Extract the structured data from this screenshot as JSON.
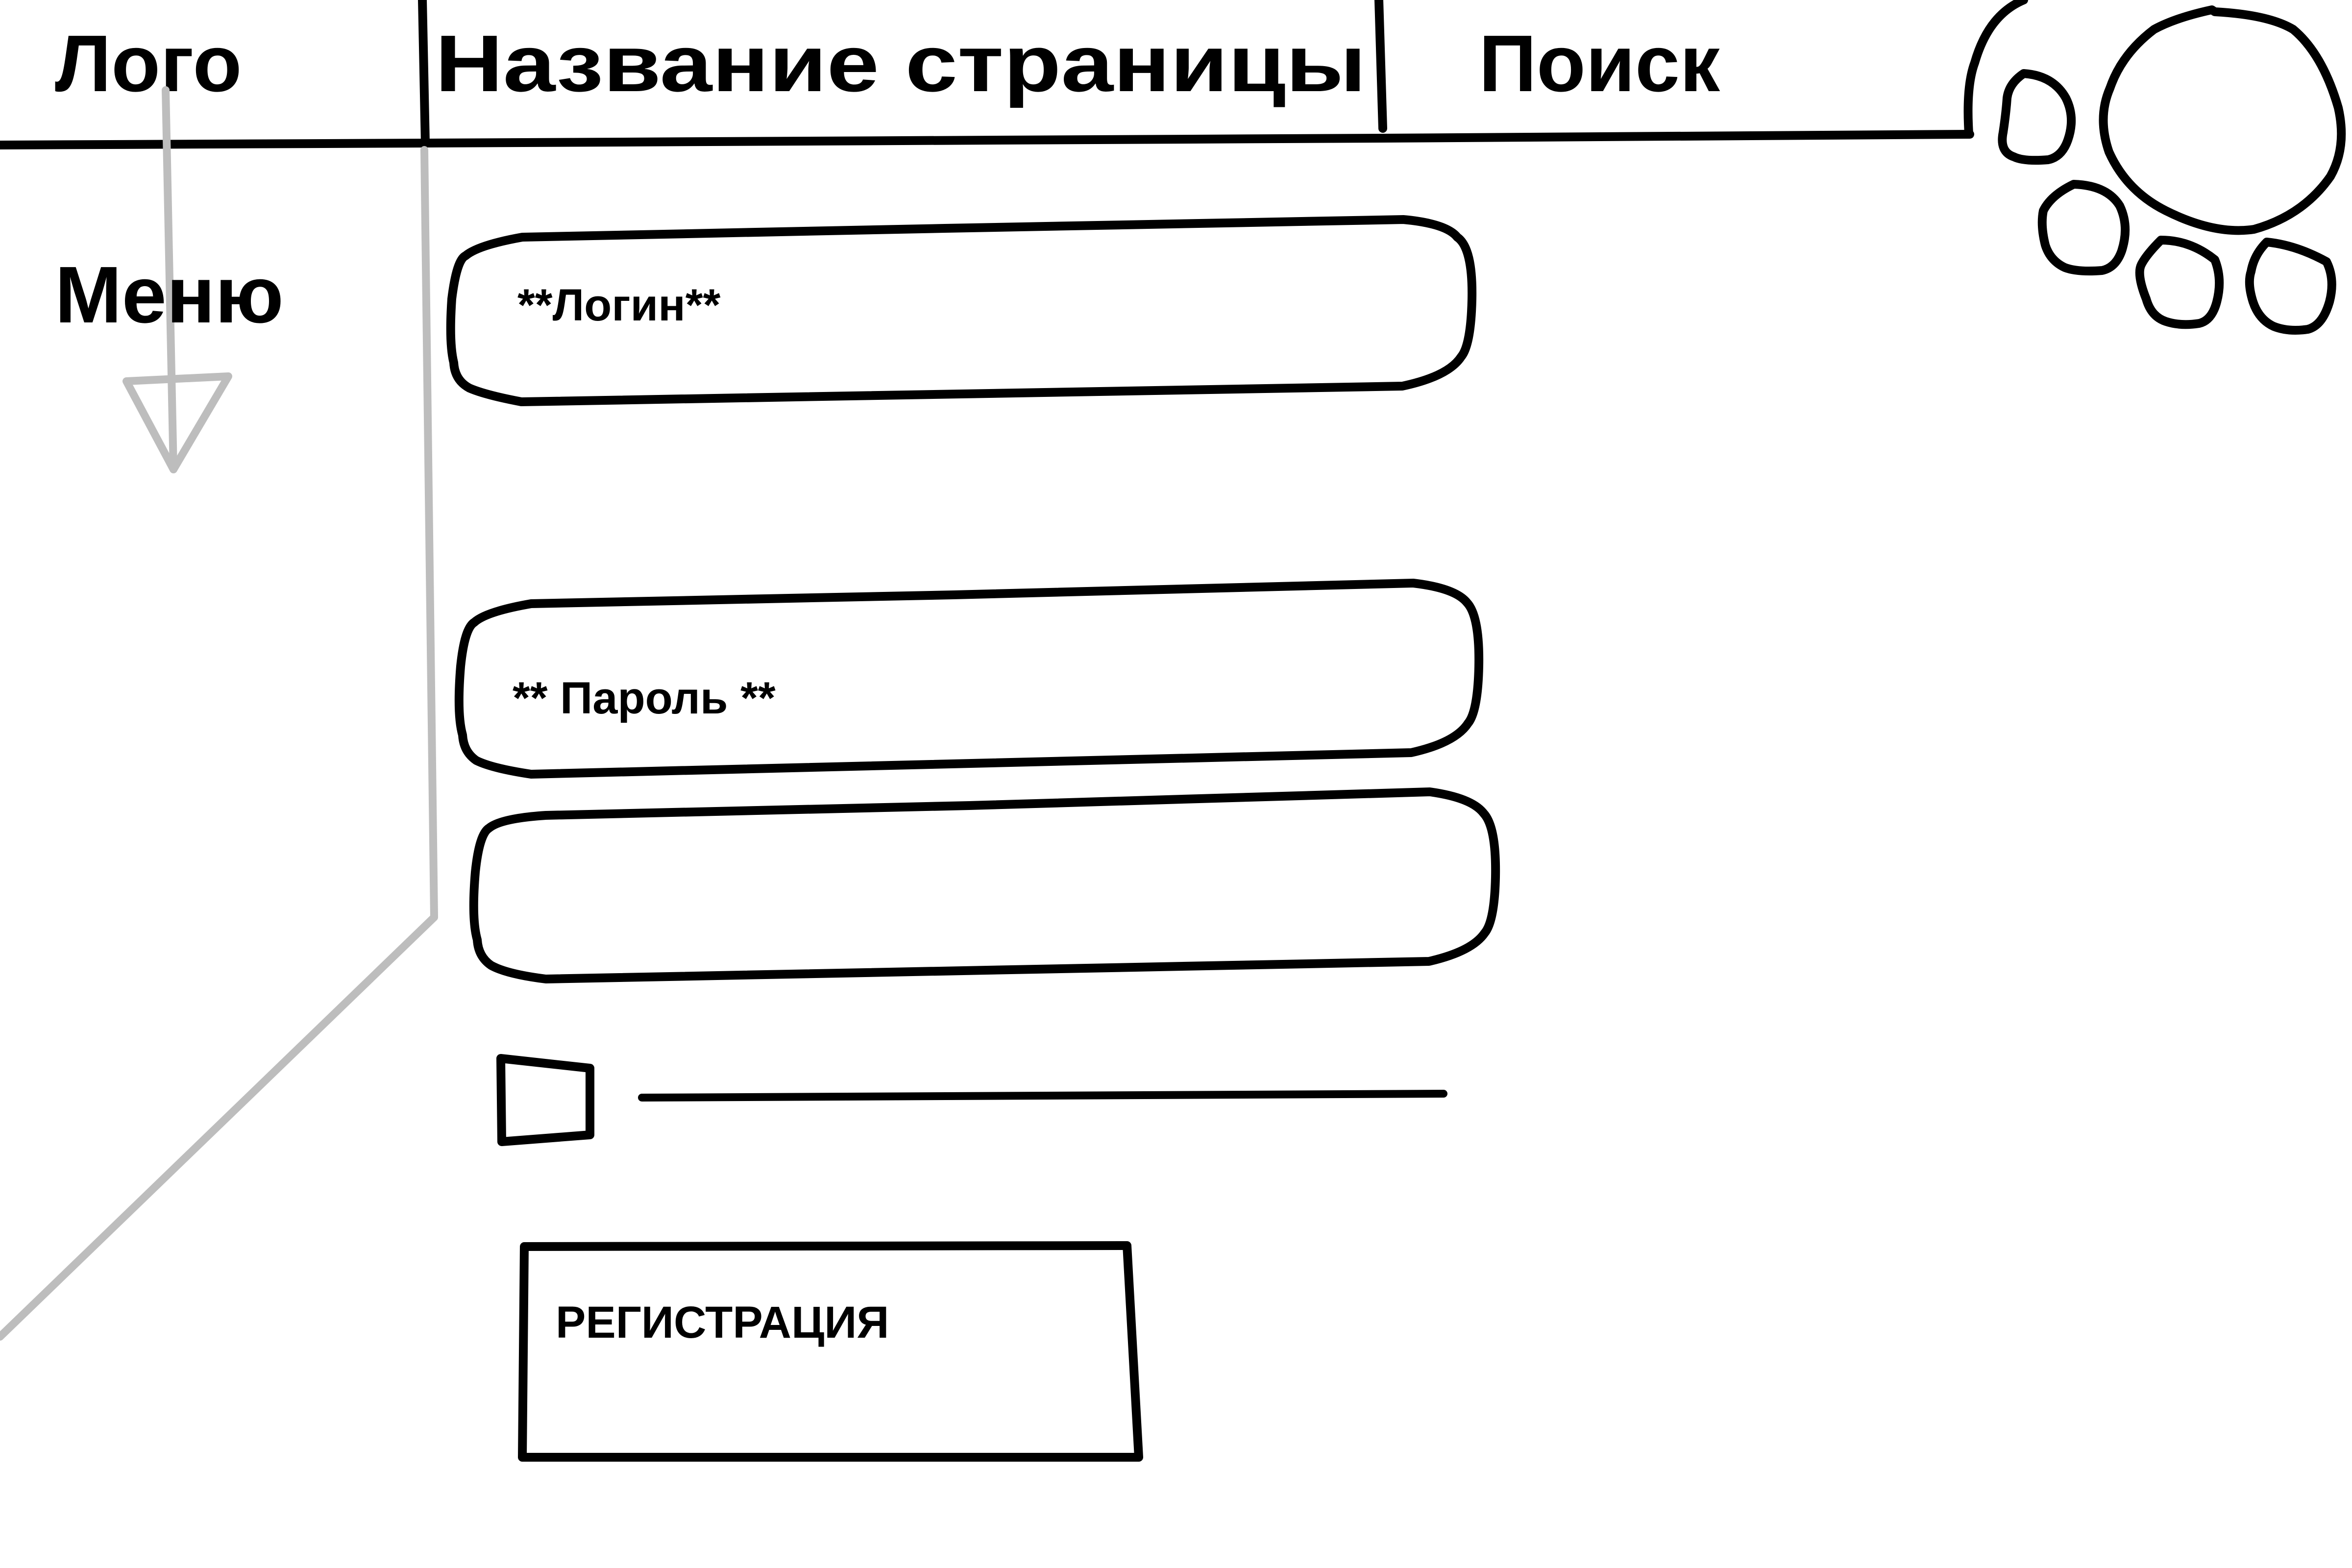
{
  "header": {
    "logo": "Лого",
    "page_title": "Название страницы",
    "search": "Поиск"
  },
  "sidebar": {
    "menu": "Меню"
  },
  "form": {
    "login_label": "**Логин**",
    "password_label": "** Пароль **",
    "extra_field_value": "",
    "checkbox_checked": false,
    "checkbox_label": "",
    "register_button": "РЕГИСТРАЦИЯ"
  },
  "colors": {
    "ink": "#000000",
    "annotation": "#bdbdbd",
    "background": "#ffffff"
  },
  "icons": {
    "user_avatar": "paw-icon",
    "menu_dropdown": "arrow-down-icon"
  }
}
